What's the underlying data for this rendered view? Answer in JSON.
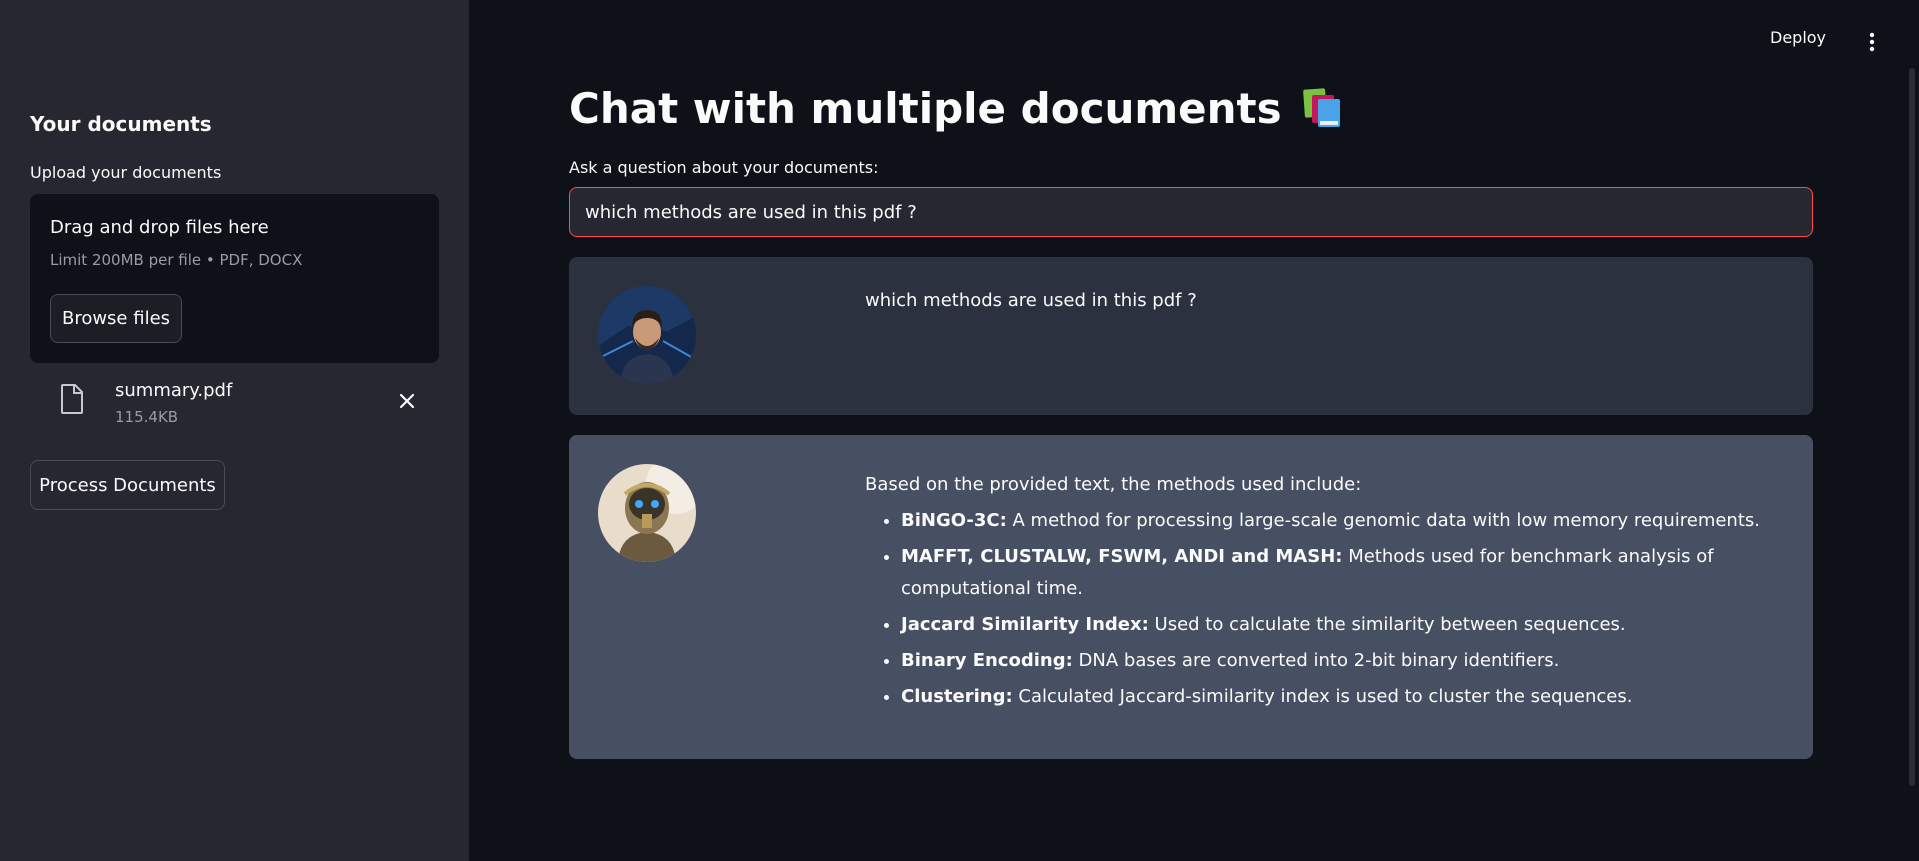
{
  "sidebar": {
    "heading": "Your documents",
    "upload_label": "Upload your documents",
    "dropzone": {
      "title": "Drag and drop files here",
      "limit": "Limit 200MB per file • PDF, DOCX",
      "browse_label": "Browse files"
    },
    "file": {
      "name": "summary.pdf",
      "size": "115.4KB"
    },
    "process_label": "Process Documents"
  },
  "topbar": {
    "deploy_label": "Deploy"
  },
  "main": {
    "title": "Chat with multiple documents",
    "question_label": "Ask a question about your documents:",
    "question_value": "which methods are used in this pdf ?",
    "user_message": "which methods are used in this pdf ?",
    "bot_intro": "Based on the provided text, the methods used include:",
    "bot_items": [
      {
        "term": "BiNGO-3C:",
        "desc": " A method for processing large-scale genomic data with low memory requirements."
      },
      {
        "term": "MAFFT, CLUSTALW, FSWM, ANDI and MASH:",
        "desc": " Methods used for benchmark analysis of computational time."
      },
      {
        "term": "Jaccard Similarity Index:",
        "desc": " Used to calculate the similarity between sequences."
      },
      {
        "term": "Binary Encoding:",
        "desc": " DNA bases are converted into 2-bit binary identifiers."
      },
      {
        "term": "Clustering:",
        "desc": " Calculated Jaccard-similarity index is used to cluster the sequences."
      }
    ]
  },
  "colors": {
    "accent": "#ff4b4b",
    "sidebar_bg": "#262730",
    "main_bg": "#0e1117",
    "user_msg_bg": "#2b313e",
    "bot_msg_bg": "#475063"
  },
  "icons": [
    "file-icon",
    "close-icon",
    "books-icon",
    "kebab-menu-icon"
  ]
}
